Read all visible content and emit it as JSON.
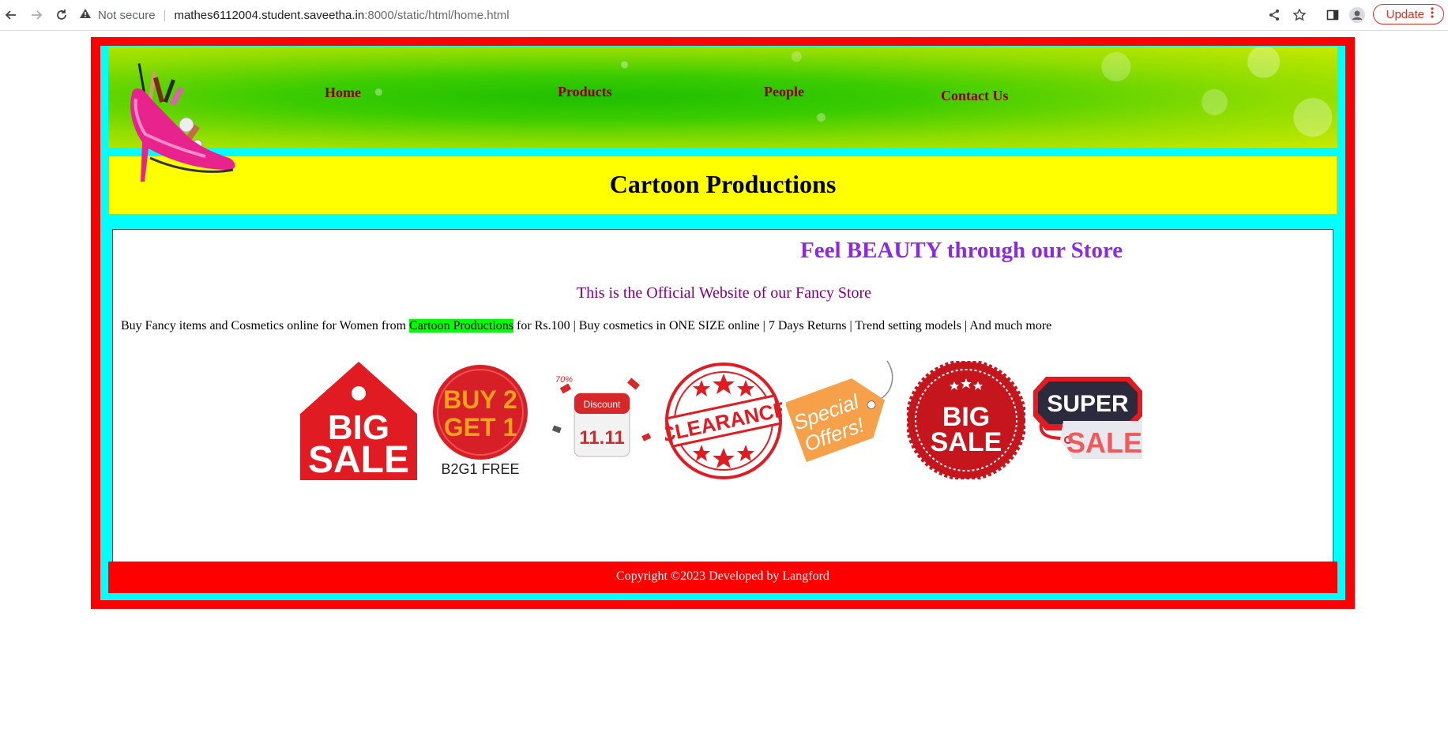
{
  "browser": {
    "security_label": "Not secure",
    "url_host": "mathes6112004.student.saveetha.in",
    "url_path": ":8000/static/html/home.html",
    "update_label": "Update"
  },
  "nav": {
    "items": [
      {
        "label": "Home"
      },
      {
        "label": "Products"
      },
      {
        "label": "People"
      },
      {
        "label": "Contact Us"
      }
    ]
  },
  "header": {
    "title": "Cartoon Productions"
  },
  "main": {
    "marquee": "Feel BEAUTY through our Store",
    "subheading": "This is the Official Website of our Fancy Store",
    "desc_before": "Buy Fancy items and Cosmetics online for Women from ",
    "desc_highlight": "Cartoon Productions",
    "desc_after": " for Rs.100 | Buy cosmetics in ONE SIZE online | 7 Days Returns | Trend setting models | And much more"
  },
  "promos": {
    "big_sale_1": [
      "BIG",
      "SALE"
    ],
    "buy2get1": [
      "BUY 2",
      "GET 1",
      "B2G1 FREE"
    ],
    "discount": [
      "Discount",
      "11.11",
      "70%"
    ],
    "clearance": "CLEARANCE",
    "special": [
      "Special",
      "Offers!"
    ],
    "big_sale_2": [
      "BIG",
      "SALE"
    ],
    "super_sale": [
      "SUPER",
      "SALE"
    ]
  },
  "footer": {
    "text": "Copyright ©2023 Developed by Langford"
  },
  "colors": {
    "border_red": "#ff0000",
    "inner_cyan": "#00ffff",
    "title_yellow": "#ffff00",
    "nav_text": "#8b0000",
    "marquee_purple": "#8a2be2",
    "highlight_green": "#00ff00"
  }
}
